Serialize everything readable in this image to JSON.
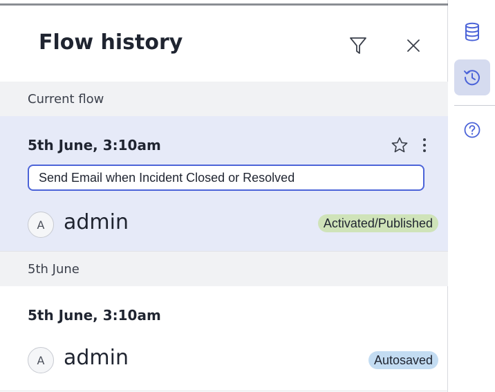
{
  "panel": {
    "title": "Flow history",
    "icons": {
      "filter": "filter-icon",
      "close": "close-icon"
    }
  },
  "sections": [
    {
      "label": "Current flow",
      "entries": [
        {
          "date": "5th June, 3:10am",
          "name_value": "Send Email when Incident Closed or Resolved",
          "avatar_initial": "A",
          "user": "admin",
          "status": "Activated/Published",
          "status_color": "#cfe3b9",
          "actions": [
            "star-icon",
            "more-vertical-icon"
          ]
        }
      ]
    },
    {
      "label": "5th June",
      "entries": [
        {
          "date": "5th June, 3:10am",
          "avatar_initial": "A",
          "user": "admin",
          "status": "Autosaved",
          "status_color": "#c3dcf2"
        }
      ]
    }
  ],
  "rail": {
    "items": [
      {
        "icon": "database-icon",
        "active": false
      },
      {
        "icon": "history-icon",
        "active": true
      },
      {
        "icon": "help-icon",
        "active": false
      }
    ]
  },
  "colors": {
    "accent": "#4b63d8",
    "selected_background": "#e6eaf8",
    "section_background": "#f1f2f4"
  }
}
